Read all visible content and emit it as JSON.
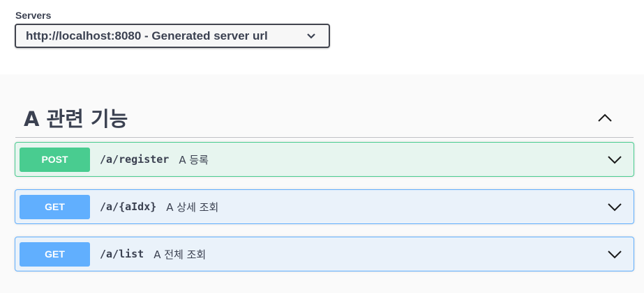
{
  "servers": {
    "label": "Servers",
    "selected": "http://localhost:8080 - Generated server url",
    "dropdown_icon": "chevron-down-icon"
  },
  "tag": {
    "title": "A 관련 기능",
    "collapse_icon": "chevron-up-icon",
    "expanded": true
  },
  "operations": [
    {
      "method": "POST",
      "path": "/a/register",
      "summary": "A 등록",
      "color": "#49cc90",
      "expand_icon": "chevron-down-icon"
    },
    {
      "method": "GET",
      "path": "/a/{aIdx}",
      "summary": "A 상세 조회",
      "color": "#61affe",
      "expand_icon": "chevron-down-icon"
    },
    {
      "method": "GET",
      "path": "/a/list",
      "summary": "A 전체 조회",
      "color": "#61affe",
      "expand_icon": "chevron-down-icon"
    }
  ],
  "colors": {
    "post": "#49cc90",
    "get": "#61affe",
    "text": "#3b4151"
  }
}
